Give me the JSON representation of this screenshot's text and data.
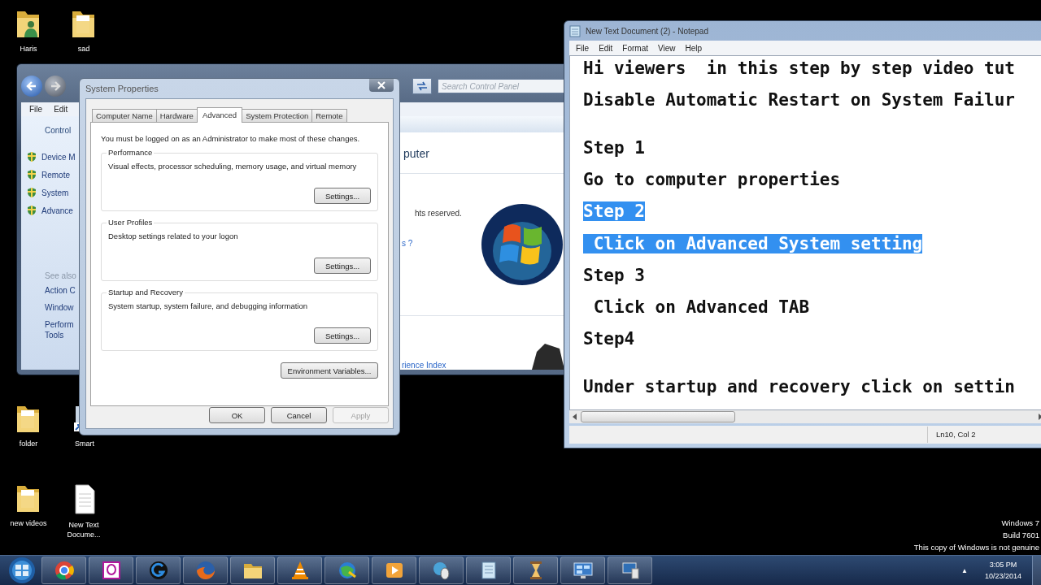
{
  "desktop_icons": [
    {
      "label": "Haris",
      "kind": "user-folder"
    },
    {
      "label": "sad",
      "kind": "folder"
    },
    {
      "label": "folder",
      "kind": "folder"
    },
    {
      "label": "Smart",
      "kind": "shortcut"
    },
    {
      "label": "new videos",
      "kind": "folder"
    },
    {
      "label": "New Text Docume...",
      "kind": "document"
    }
  ],
  "control_panel": {
    "search_placeholder": "Search Control Panel",
    "menu": [
      "File",
      "Edit"
    ],
    "left_pane": {
      "home_link": "Control",
      "tasks": [
        "Device M",
        "Remote",
        "System",
        "Advance"
      ],
      "see_also_heading": "See also",
      "see_also": [
        "Action C",
        "Window",
        "Perform Tools"
      ]
    },
    "content": {
      "heading": "puter",
      "copyright": "hts reserved.",
      "link": "s ?",
      "rating_link": "rience Index"
    }
  },
  "system_properties": {
    "title": "System Properties",
    "tabs": [
      {
        "label": "Computer Name",
        "selected": false
      },
      {
        "label": "Hardware",
        "selected": false
      },
      {
        "label": "Advanced",
        "selected": true
      },
      {
        "label": "System Protection",
        "selected": false
      },
      {
        "label": "Remote",
        "selected": false
      }
    ],
    "note": "You must be logged on as an Administrator to make most of these changes.",
    "groups": [
      {
        "title": "Performance",
        "description": "Visual effects, processor scheduling, memory usage, and virtual memory",
        "button": "Settings..."
      },
      {
        "title": "User Profiles",
        "description": "Desktop settings related to your logon",
        "button": "Settings..."
      },
      {
        "title": "Startup and Recovery",
        "description": "System startup, system failure, and debugging information",
        "button": "Settings..."
      }
    ],
    "environment_button": "Environment Variables...",
    "buttons": [
      {
        "label": "OK",
        "disabled": false
      },
      {
        "label": "Cancel",
        "disabled": false
      },
      {
        "label": "Apply",
        "disabled": true
      }
    ]
  },
  "notepad": {
    "title": "New Text Document (2) - Notepad",
    "menu": [
      "File",
      "Edit",
      "Format",
      "View",
      "Help"
    ],
    "lines": [
      {
        "kind": "text",
        "text": "Hi viewers  in this step by step video tut",
        "selected": false
      },
      {
        "kind": "blank"
      },
      {
        "kind": "text",
        "text": "Disable Automatic Restart on System Failur",
        "selected": false
      },
      {
        "kind": "blank"
      },
      {
        "kind": "blank"
      },
      {
        "kind": "text",
        "text": "Step 1",
        "selected": false
      },
      {
        "kind": "blank"
      },
      {
        "kind": "text",
        "text": "Go to computer properties",
        "selected": false
      },
      {
        "kind": "blank"
      },
      {
        "kind": "text",
        "text": "Step 2",
        "selected": true
      },
      {
        "kind": "blank"
      },
      {
        "kind": "text",
        "text": " Click on Advanced System setting",
        "selected": true
      },
      {
        "kind": "blank"
      },
      {
        "kind": "text",
        "text": "Step 3",
        "selected": false
      },
      {
        "kind": "blank"
      },
      {
        "kind": "text",
        "text": " Click on Advanced TAB",
        "selected": false
      },
      {
        "kind": "blank"
      },
      {
        "kind": "text",
        "text": "Step4",
        "selected": false
      },
      {
        "kind": "blank"
      },
      {
        "kind": "blank"
      },
      {
        "kind": "text",
        "text": "Under startup and recovery click on settin",
        "selected": false
      }
    ],
    "status": "Ln10, Col 2"
  },
  "genuine_notice": [
    "Windows 7",
    "Build 7601",
    "This copy of Windows is not genuine"
  ],
  "taskbar": {
    "apps": [
      {
        "kind": "browser"
      },
      {
        "kind": "chat"
      },
      {
        "kind": "letter"
      },
      {
        "kind": "fox"
      },
      {
        "kind": "folder"
      },
      {
        "kind": "cone"
      },
      {
        "kind": "globe"
      },
      {
        "kind": "media"
      },
      {
        "kind": "mouse"
      },
      {
        "kind": "notepad"
      },
      {
        "kind": "hourglass"
      },
      {
        "kind": "monitor"
      },
      {
        "kind": "computer"
      }
    ],
    "tray_arrow": "▲",
    "time": "3:05 PM",
    "date": "10/23/2014"
  }
}
